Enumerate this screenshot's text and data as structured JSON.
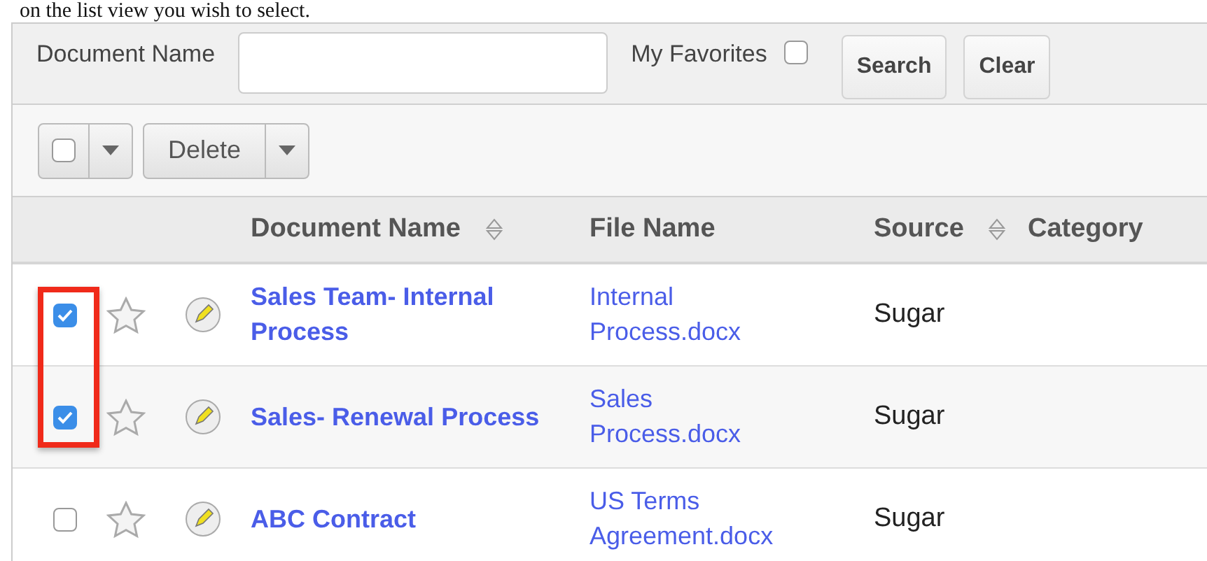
{
  "caption": "on the list view you wish to select.",
  "filter": {
    "name_label": "Document Name",
    "favorites_label": "My Favorites",
    "favorites_checked": false,
    "search_button": "Search",
    "clear_button": "Clear"
  },
  "toolbar": {
    "select_all_checked": false,
    "action_button": "Delete"
  },
  "table": {
    "columns": [
      {
        "label": "Document Name",
        "sortable": true
      },
      {
        "label": "File Name",
        "sortable": false
      },
      {
        "label": "Source",
        "sortable": true
      },
      {
        "label": "Category",
        "sortable": false
      }
    ],
    "rows": [
      {
        "checked": true,
        "favorite": false,
        "highlighted": true,
        "document_name": "Sales Team- Internal Process",
        "file_name": "Internal Process.docx",
        "source": "Sugar"
      },
      {
        "checked": true,
        "favorite": false,
        "highlighted": true,
        "document_name": "Sales- Renewal Process",
        "file_name": "Sales Process.docx",
        "source": "Sugar"
      },
      {
        "checked": false,
        "favorite": false,
        "highlighted": false,
        "document_name": "ABC Contract",
        "file_name": "US Terms Agreement.docx",
        "source": "Sugar"
      }
    ]
  }
}
